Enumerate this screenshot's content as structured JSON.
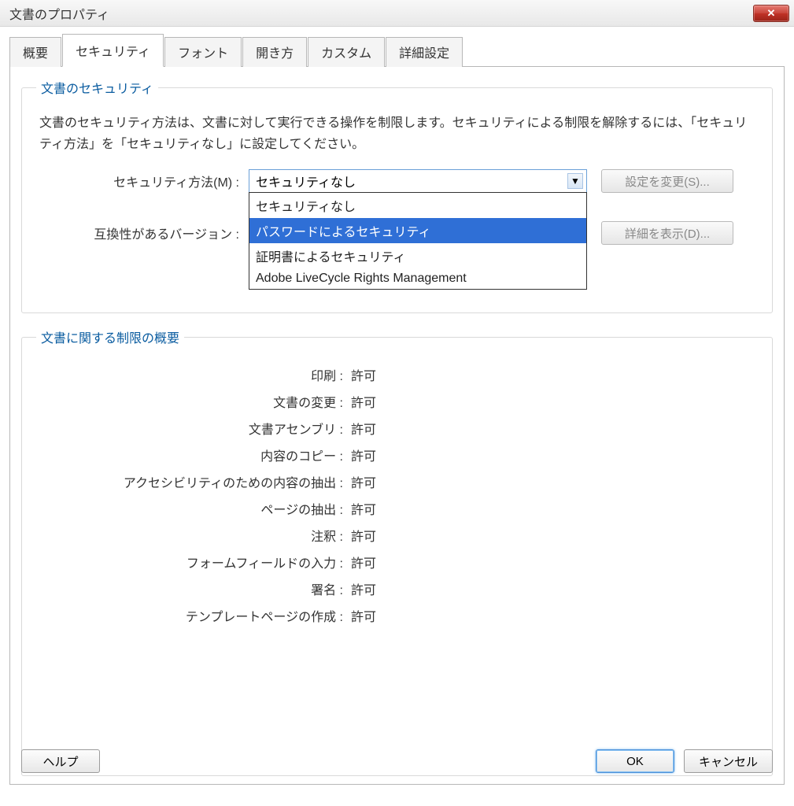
{
  "window": {
    "title": "文書のプロパティ"
  },
  "tabs": [
    {
      "label": "概要"
    },
    {
      "label": "セキュリティ"
    },
    {
      "label": "フォント"
    },
    {
      "label": "開き方"
    },
    {
      "label": "カスタム"
    },
    {
      "label": "詳細設定"
    }
  ],
  "security": {
    "groupTitle": "文書のセキュリティ",
    "description": "文書のセキュリティ方法は、文書に対して実行できる操作を制限します。セキュリティによる制限を解除するには、「セキュリティ方法」を「セキュリティなし」に設定してください。",
    "methodLabel": "セキュリティ方法(M) :",
    "methodValue": "セキュリティなし",
    "options": [
      "セキュリティなし",
      "パスワードによるセキュリティ",
      "証明書によるセキュリティ",
      "Adobe LiveCycle Rights Management"
    ],
    "selectedOptionIndex": 1,
    "compatLabel": "互換性があるバージョン :",
    "changeSettingsBtn": "設定を変更(S)...",
    "showDetailsBtn": "詳細を表示(D)..."
  },
  "restrictions": {
    "groupTitle": "文書に関する制限の概要",
    "items": [
      {
        "label": "印刷 :",
        "value": "許可"
      },
      {
        "label": "文書の変更 :",
        "value": "許可"
      },
      {
        "label": "文書アセンブリ :",
        "value": "許可"
      },
      {
        "label": "内容のコピー :",
        "value": "許可"
      },
      {
        "label": "アクセシビリティのための内容の抽出 :",
        "value": "許可"
      },
      {
        "label": "ページの抽出 :",
        "value": "許可"
      },
      {
        "label": "注釈 :",
        "value": "許可"
      },
      {
        "label": "フォームフィールドの入力 :",
        "value": "許可"
      },
      {
        "label": "署名 :",
        "value": "許可"
      },
      {
        "label": "テンプレートページの作成 :",
        "value": "許可"
      }
    ]
  },
  "buttons": {
    "help": "ヘルプ",
    "ok": "OK",
    "cancel": "キャンセル"
  }
}
